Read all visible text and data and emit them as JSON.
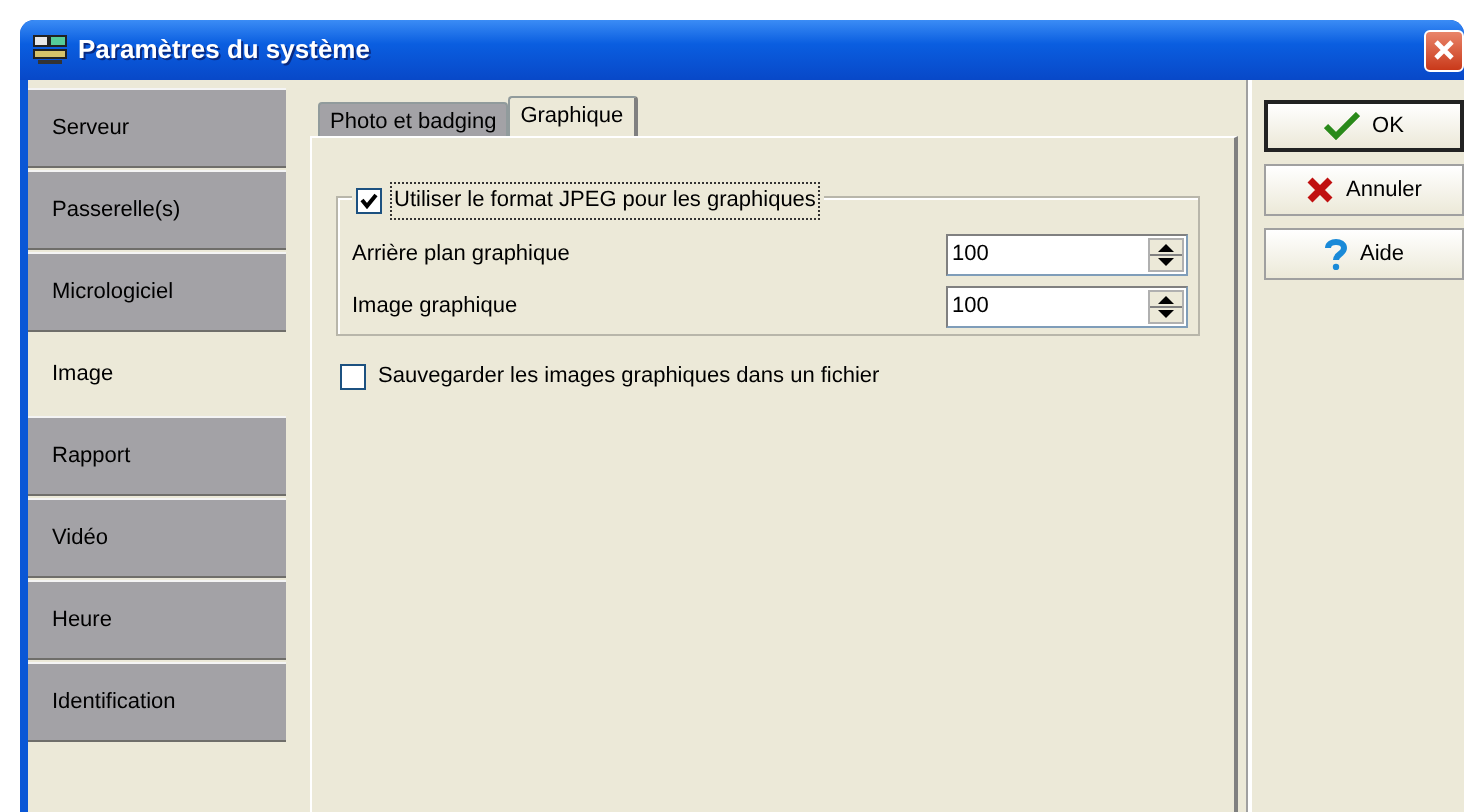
{
  "window": {
    "title": "Paramètres du système"
  },
  "sidebar": {
    "items": [
      {
        "label": "Serveur",
        "selected": false
      },
      {
        "label": "Passerelle(s)",
        "selected": false
      },
      {
        "label": "Micrologiciel",
        "selected": false
      },
      {
        "label": "Image",
        "selected": true
      },
      {
        "label": "Rapport",
        "selected": false
      },
      {
        "label": "Vidéo",
        "selected": false
      },
      {
        "label": "Heure",
        "selected": false
      },
      {
        "label": "Identification",
        "selected": false
      }
    ]
  },
  "tabs": [
    {
      "label": "Photo et badging",
      "selected": false
    },
    {
      "label": "Graphique",
      "selected": true
    }
  ],
  "jpeg_group": {
    "label": "Utiliser le format JPEG pour les graphiques",
    "checked": true,
    "focused": true,
    "fields": [
      {
        "label": "Arrière plan graphique",
        "value": "100"
      },
      {
        "label": "Image graphique",
        "value": "100"
      }
    ]
  },
  "save_option": {
    "label": "Sauvegarder les images graphiques dans un fichier",
    "checked": false
  },
  "buttons": [
    {
      "label": "OK",
      "kind": "ok",
      "default": true
    },
    {
      "label": "Annuler",
      "kind": "cancel",
      "default": false
    },
    {
      "label": "Aide",
      "kind": "help",
      "default": false
    }
  ]
}
